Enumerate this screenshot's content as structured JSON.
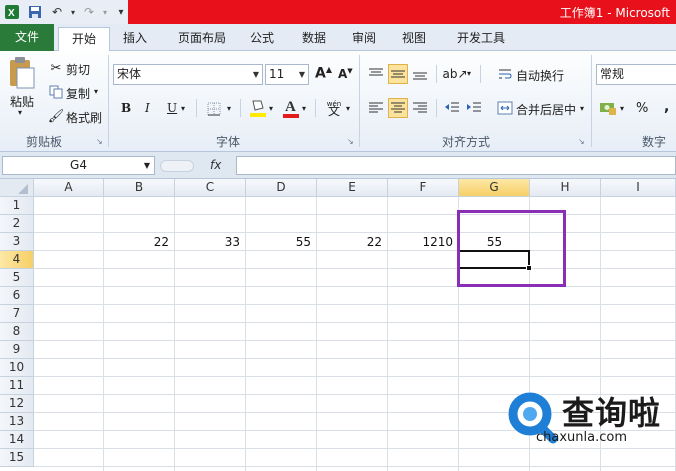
{
  "titlebar": {
    "title": "工作簿1 - Microsoft"
  },
  "tabs": [
    "文件",
    "开始",
    "插入",
    "页面布局",
    "公式",
    "数据",
    "审阅",
    "视图",
    "开发工具"
  ],
  "clipboard": {
    "paste": "粘贴",
    "cut": "剪切",
    "copy": "复制",
    "format_painter": "格式刷",
    "group": "剪贴板"
  },
  "font": {
    "name": "宋体",
    "size": "11",
    "grow": "A",
    "shrink": "A",
    "bold": "B",
    "italic": "I",
    "underline": "U",
    "group": "字体",
    "phonetic": "wén"
  },
  "alignment": {
    "wrap": "自动换行",
    "merge": "合并后居中",
    "group": "对齐方式"
  },
  "number": {
    "format": "常规",
    "percent": "%",
    "comma": ",",
    "group": "数字"
  },
  "formula_bar": {
    "name_box": "G4",
    "fx": "fx",
    "value": ""
  },
  "columns": [
    "A",
    "B",
    "C",
    "D",
    "E",
    "F",
    "G",
    "H",
    "I"
  ],
  "selected_column": "G",
  "rows": [
    "1",
    "2",
    "3",
    "4",
    "5",
    "6",
    "7",
    "8",
    "9",
    "10",
    "11",
    "12",
    "13",
    "14",
    "15"
  ],
  "selected_row": "4",
  "cells": {
    "B3": "22",
    "C3": "33",
    "D3": "55",
    "E3": "22",
    "F3": "1210",
    "G3": "55"
  },
  "active_cell": "G4",
  "colors": {
    "title_bar": "#e8101a",
    "file_tab": "#2a7a3a",
    "highlight_box": "#8a2fb5",
    "watermark_blue": "#1f7fd6"
  },
  "watermark": {
    "text": "查询啦",
    "url": "chaxunla.com"
  }
}
